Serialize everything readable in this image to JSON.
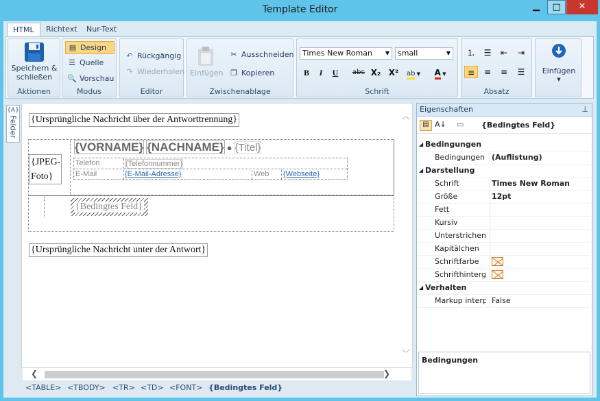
{
  "window": {
    "title": "Template Editor",
    "minimize": "▁",
    "maximize": "□",
    "close": "✕"
  },
  "tabs": [
    "HTML",
    "Richtext",
    "Nur-Text"
  ],
  "ribbon": {
    "aktionen": {
      "label": "Aktionen",
      "save": "Speichern & schließen"
    },
    "modus": {
      "label": "Modus",
      "design": "Design",
      "quelle": "Quelle",
      "vorschau": "Vorschau"
    },
    "editor": {
      "label": "Editor",
      "undo": "Rückgängig",
      "redo": "Wiederholen"
    },
    "zwischenablage": {
      "label": "Zwischenablage",
      "paste": "Einfügen",
      "cut": "Ausschneiden",
      "copy": "Kopieren"
    },
    "schrift": {
      "label": "Schrift",
      "font": "Times New Roman",
      "size": "small",
      "bold": "B",
      "italic": "I",
      "underline": "U",
      "strike": "abc",
      "sub": "X₂",
      "sup": "X²"
    },
    "absatz": {
      "label": "Absatz"
    },
    "insert": {
      "label": "Einfügen"
    }
  },
  "felder_tab": "Felder",
  "editor": {
    "top_line": "{Ursprüngliche Nachricht über der Antworttrennung}",
    "photo": "{JPEG-Foto}",
    "vorname": "{VORNAME}",
    "nachname": "{NACHNAME}",
    "bullet": "●",
    "titel": "{Titel}",
    "telefon_label": "Telefon",
    "telefon_value": "{Telefonnummer}",
    "email_label": "E-Mail",
    "email_value": "{E-Mail-Adresse}",
    "web_label": "Web",
    "web_value": "{Webseite}",
    "conditional": "{Bedingtes Feld}",
    "bottom_line": "{Ursprüngliche Nachricht unter der Antwort}"
  },
  "statusbar": [
    "<TABLE>",
    "<TBODY>",
    "<TR>",
    "<TD>",
    "<FONT>",
    "{Bedingtes Feld}"
  ],
  "props": {
    "header": "Eigenschaften",
    "object": "{Bedingtes Feld}",
    "rows": [
      {
        "type": "cat",
        "name": "Bedingungen"
      },
      {
        "type": "prop",
        "name": "Bedingungen",
        "value": "(Auflistung)"
      },
      {
        "type": "cat",
        "name": "Darstellung"
      },
      {
        "type": "prop",
        "name": "Schrift",
        "value": "Times New Roman"
      },
      {
        "type": "prop",
        "name": "Größe",
        "value": "12pt"
      },
      {
        "type": "prop",
        "name": "Fett",
        "value": ""
      },
      {
        "type": "prop",
        "name": "Kursiv",
        "value": ""
      },
      {
        "type": "prop",
        "name": "Unterstrichen",
        "value": ""
      },
      {
        "type": "prop",
        "name": "Kapitälchen",
        "value": ""
      },
      {
        "type": "prop",
        "name": "Schriftfarbe",
        "value": "",
        "swatch": true
      },
      {
        "type": "prop",
        "name": "Schrifthintergr",
        "value": "",
        "swatch": true
      },
      {
        "type": "cat",
        "name": "Verhalten"
      },
      {
        "type": "prop",
        "name": "Markup interp",
        "value": "False",
        "normal": true
      }
    ],
    "description_title": "Bedingungen"
  }
}
